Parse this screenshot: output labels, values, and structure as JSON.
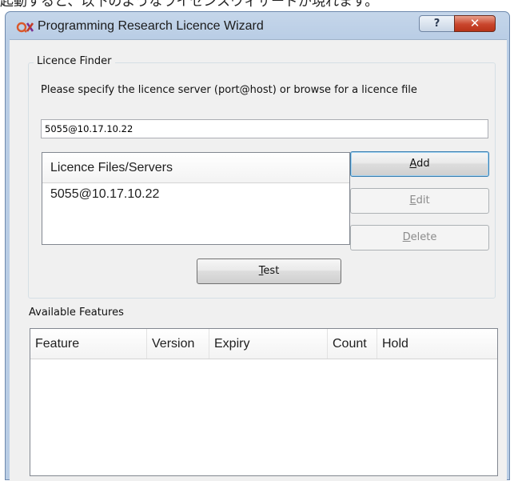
{
  "background_caption": "起動すると、以下のようなライセンスウィザードが現れます。",
  "window": {
    "title": "Programming Research Licence Wizard",
    "help_label": "?",
    "close_label": "✕",
    "app_icon": "qac-logo-icon"
  },
  "finder": {
    "legend": "Licence Finder",
    "prompt": "Please specify the licence server (port@host) or browse for a licence file",
    "server_value": "5055@10.17.10.22",
    "list_header": "Licence Files/Servers",
    "list_items": [
      "5055@10.17.10.22"
    ],
    "buttons": {
      "add": {
        "mnemonic": "A",
        "rest": "dd"
      },
      "edit": {
        "mnemonic": "E",
        "rest": "dit"
      },
      "delete": {
        "mnemonic": "D",
        "rest": "elete"
      },
      "test": {
        "mnemonic": "T",
        "rest": "est"
      }
    }
  },
  "features": {
    "label": "Available Features",
    "columns": [
      "Feature",
      "Version",
      "Expiry",
      "Count",
      "Hold"
    ]
  },
  "colors": {
    "title_bar": "#b9cde5",
    "close_button": "#c9452c",
    "default_button_border": "#3c7fb1"
  }
}
